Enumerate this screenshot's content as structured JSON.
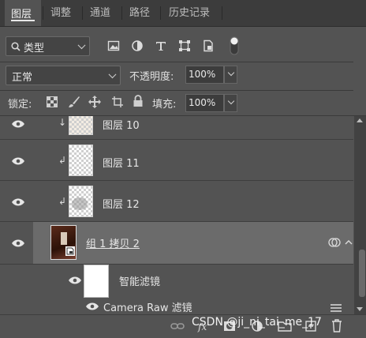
{
  "tabs": [
    {
      "label": "图层",
      "active": true
    },
    {
      "label": "调整"
    },
    {
      "label": "通道"
    },
    {
      "label": "路径"
    },
    {
      "label": "历史记录"
    }
  ],
  "filter": {
    "kind_label": "类型"
  },
  "blend": {
    "mode": "正常",
    "opacity_label": "不透明度:",
    "opacity_value": "100%"
  },
  "lock": {
    "label": "锁定:",
    "fill_label": "填充:",
    "fill_value": "100%"
  },
  "layers": [
    {
      "name": "图层 10",
      "clipped": true
    },
    {
      "name": "图层 11",
      "clipped": true
    },
    {
      "name": "图层 12",
      "clipped": true
    },
    {
      "name": "组 1 拷贝 2",
      "selected": true
    },
    {
      "name": "智能滤镜"
    },
    {
      "name": "Camera Raw 滤镜"
    }
  ],
  "watermark": "CSDN @ji_ni_tai_me_17",
  "colors": {
    "panel": "#535353",
    "tabbar": "#3c3c3c",
    "selected_row": "#6b6b6b"
  },
  "icons": [
    "search-icon",
    "image-filter-icon",
    "adjustment-filter-icon",
    "type-filter-icon",
    "shape-filter-icon",
    "smart-object-filter-icon",
    "filter-toggle-icon",
    "lock-transparency-icon",
    "lock-paint-icon",
    "lock-move-icon",
    "lock-artboard-icon",
    "lock-all-icon",
    "eye-icon",
    "link-icon",
    "fx-icon",
    "mask-icon",
    "new-fill-icon",
    "folder-icon",
    "new-layer-icon",
    "trash-icon"
  ]
}
